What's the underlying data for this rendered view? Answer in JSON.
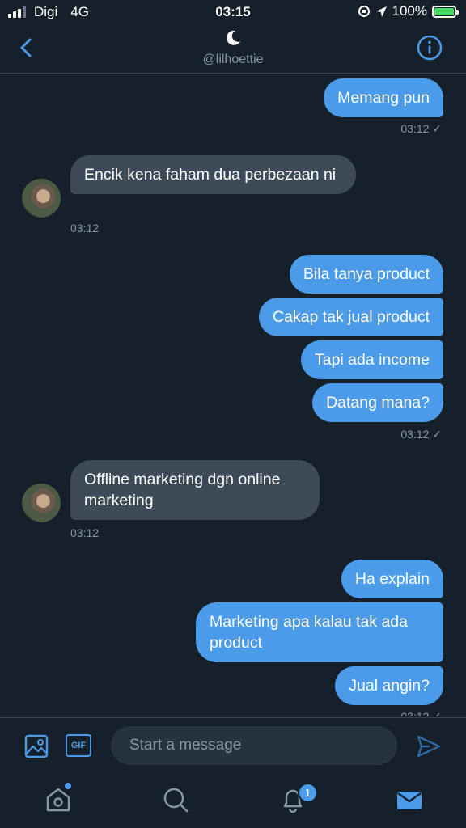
{
  "status_bar": {
    "carrier": "Digi",
    "network": "4G",
    "time": "03:15",
    "battery": "100%"
  },
  "header": {
    "handle": "@lilhoettie",
    "icons": [
      "back-chevron-icon",
      "moon-icon",
      "info-icon"
    ]
  },
  "messages": [
    {
      "side": "sent",
      "text": "Memang pun"
    },
    {
      "side": "sent_time",
      "text": "03:12 ✓"
    },
    {
      "side": "recv",
      "text": "Encik kena faham dua perbezaan ni"
    },
    {
      "side": "recv_time",
      "text": "03:12"
    },
    {
      "side": "sent",
      "text": "Bila tanya product"
    },
    {
      "side": "sent",
      "text": "Cakap tak jual product"
    },
    {
      "side": "sent",
      "text": "Tapi ada income"
    },
    {
      "side": "sent",
      "text": "Datang mana?"
    },
    {
      "side": "sent_time",
      "text": "03:12 ✓"
    },
    {
      "side": "recv",
      "text": "Offline marketing dgn online marketing"
    },
    {
      "side": "recv_time",
      "text": "03:12"
    },
    {
      "side": "sent",
      "text": "Ha explain"
    },
    {
      "side": "sent",
      "text": "Marketing apa kalau tak ada product"
    },
    {
      "side": "sent",
      "text": "Jual angin?"
    },
    {
      "side": "sent_time",
      "text": "03:12 ✓"
    }
  ],
  "composer": {
    "placeholder": "Start a message",
    "gif_label": "GIF"
  },
  "tabbar": {
    "notifications_badge": "1"
  },
  "colors": {
    "background": "#15202b",
    "sent_bubble": "#4c9be8",
    "received_bubble": "#3d4b58",
    "accent": "#1d9bf0"
  }
}
